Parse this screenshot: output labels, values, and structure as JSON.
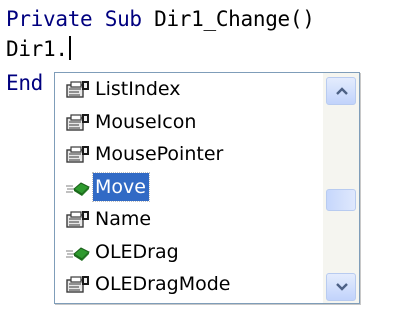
{
  "code": {
    "line1_keyword1": "Private",
    "line1_keyword2": "Sub",
    "line1_name": "Dir1_Change()",
    "line2_text": "Dir1.",
    "line3_keyword": "End Sub"
  },
  "completion_list": {
    "items": [
      {
        "label": "ListIndex",
        "icon": "property-icon",
        "selected": false
      },
      {
        "label": "MouseIcon",
        "icon": "property-icon",
        "selected": false
      },
      {
        "label": "MousePointer",
        "icon": "property-icon",
        "selected": false
      },
      {
        "label": "Move",
        "icon": "method-icon",
        "selected": true
      },
      {
        "label": "Name",
        "icon": "property-icon",
        "selected": false
      },
      {
        "label": "OLEDrag",
        "icon": "method-icon",
        "selected": false
      },
      {
        "label": "OLEDragMode",
        "icon": "property-icon",
        "selected": false
      }
    ],
    "scroll_position": 0.5
  },
  "colors": {
    "keyword": "#00007f",
    "selection": "#316ac5",
    "border": "#7f9db9"
  }
}
